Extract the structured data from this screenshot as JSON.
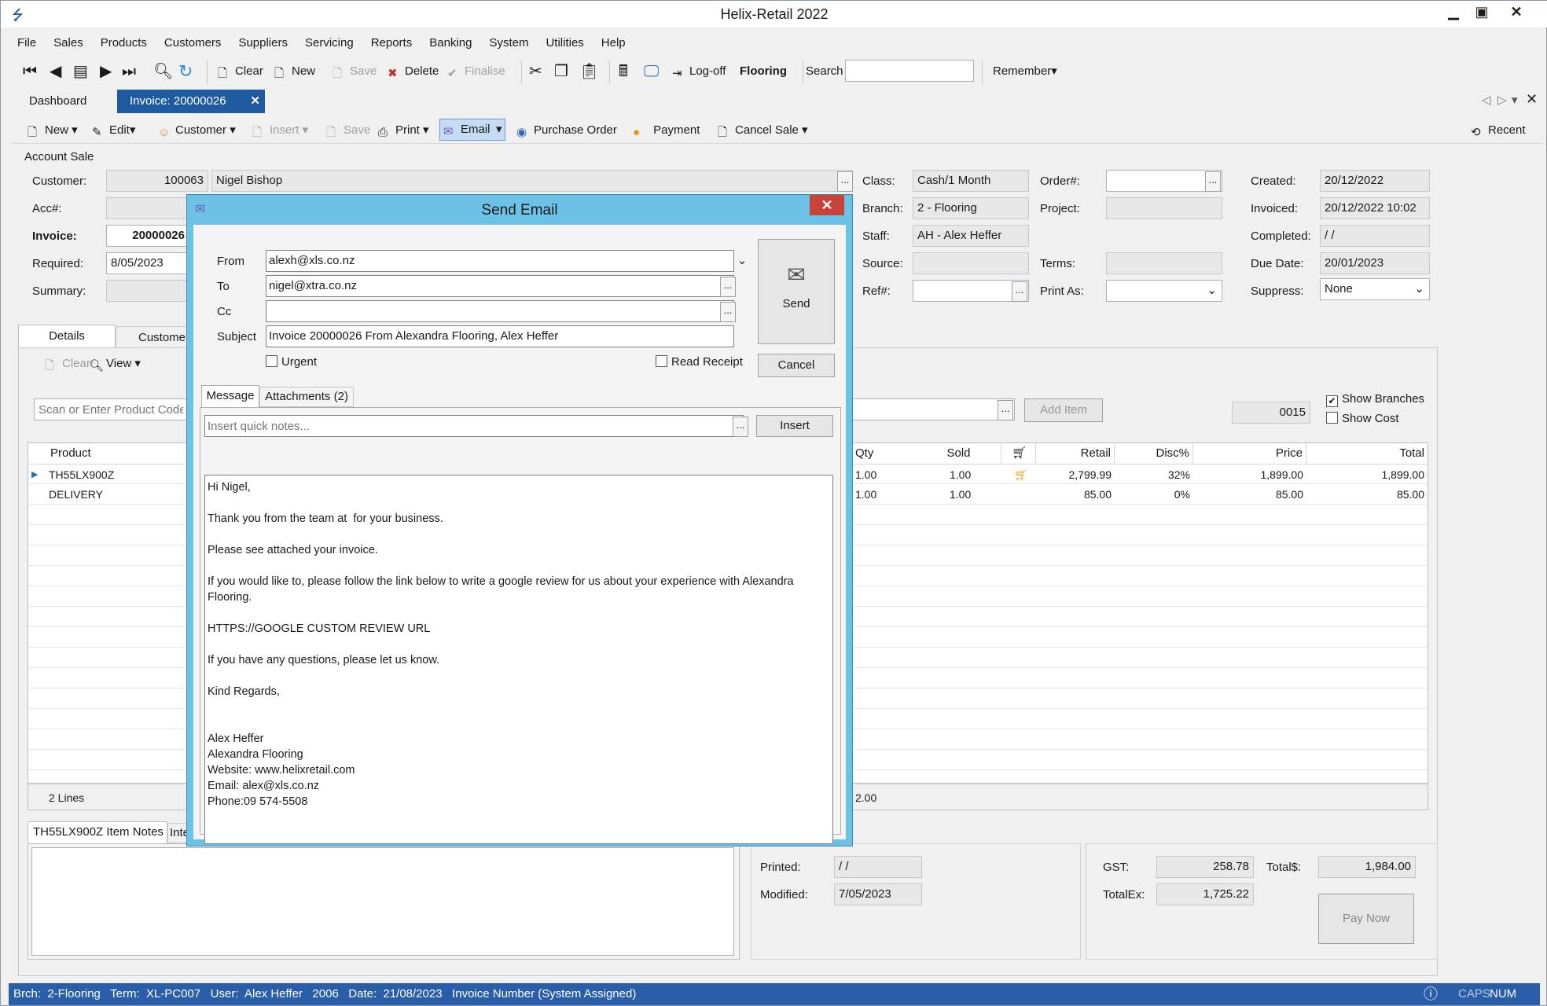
{
  "app": {
    "title": "Helix-Retail 2022"
  },
  "menu": [
    "File",
    "Sales",
    "Products",
    "Customers",
    "Suppliers",
    "Servicing",
    "Reports",
    "Banking",
    "System",
    "Utilities",
    "Help"
  ],
  "toolbar": {
    "clear": "Clear",
    "new": "New",
    "save": "Save",
    "delete": "Delete",
    "finalise": "Finalise",
    "logoff": "Log-off",
    "branch": "Flooring",
    "search_label": "Search",
    "search_value": "",
    "remember": "Remember"
  },
  "doctabs": {
    "dashboard": "Dashboard",
    "invoice": "Invoice: 20000026"
  },
  "invtoolbar": {
    "new": "New",
    "edit": "Edit",
    "customer": "Customer",
    "insert": "Insert",
    "save": "Save",
    "print": "Print",
    "email": "Email",
    "purchase_order": "Purchase Order",
    "payment": "Payment",
    "cancel_sale": "Cancel Sale",
    "recent": "Recent"
  },
  "account": {
    "section": "Account Sale",
    "customer_label": "Customer:",
    "customer_code": "100063",
    "customer_name": "Nigel Bishop",
    "acc_label": "Acc#:",
    "invoice_label": "Invoice:",
    "invoice_value": "20000026",
    "required_label": "Required:",
    "required_value": "8/05/2023",
    "summary_label": "Summary:",
    "class_label": "Class:",
    "class_value": "Cash/1 Month",
    "branch_label": "Branch:",
    "branch_value": "2 - Flooring",
    "staff_label": "Staff:",
    "staff_value": "AH - Alex Heffer",
    "source_label": "Source:",
    "ref_label": "Ref#:",
    "order_label": "Order#:",
    "project_label": "Project:",
    "terms_label": "Terms:",
    "printas_label": "Print As:",
    "created_label": "Created:",
    "created_value": "20/12/2022",
    "invoiced_label": "Invoiced:",
    "invoiced_value": "20/12/2022 10:02",
    "completed_label": "Completed:",
    "completed_value": " /  /",
    "due_label": "Due Date:",
    "due_value": "20/01/2023",
    "suppress_label": "Suppress:",
    "suppress_value": "None"
  },
  "details": {
    "tab_details": "Details",
    "tab_customer": "Customer",
    "clear": "Clear",
    "view": "View",
    "scan_placeholder": "Scan or Enter Product Code",
    "add_item": "Add Item",
    "code": "0015",
    "show_branches": "Show Branches",
    "show_cost": "Show Cost",
    "headers": {
      "product": "Product",
      "qty": "Qty",
      "sold": "Sold",
      "retail": "Retail",
      "disc": "Disc%",
      "price": "Price",
      "total": "Total"
    },
    "rows": [
      {
        "product": "TH55LX900Z",
        "qty": "1.00",
        "sold": "1.00",
        "retail": "2,799.99",
        "disc": "32%",
        "price": "1,899.00",
        "total": "1,899.00"
      },
      {
        "product": "DELIVERY",
        "qty": "1.00",
        "sold": "1.00",
        "retail": "85.00",
        "disc": "0%",
        "price": "85.00",
        "total": "85.00"
      }
    ],
    "lines": "2 Lines",
    "qty_total": "2.00"
  },
  "notes": {
    "tab_item": "TH55LX900Z Item Notes",
    "tab_internal": "Inte"
  },
  "totals": {
    "printed_label": "Printed:",
    "printed_value": " /  /",
    "modified_label": "Modified:",
    "modified_value": "7/05/2023",
    "gst_label": "GST:",
    "gst_value": "258.78",
    "totalex_label": "TotalEx:",
    "totalex_value": "1,725.22",
    "total_label": "Total$:",
    "total_value": "1,984.00",
    "pay_now": "Pay Now"
  },
  "status": {
    "text": "Brch:  2-Flooring   Term:  XL-PC007   User:  Alex Heffer   2006   Date:  21/08/2023   Invoice Number (System Assigned)",
    "caps": "CAPS",
    "num": "NUM"
  },
  "dialog": {
    "title": "Send Email",
    "from_label": "From",
    "from_value": "alexh@xls.co.nz",
    "to_label": "To",
    "to_value": "nigel@xtra.co.nz",
    "cc_label": "Cc",
    "cc_value": "",
    "subject_label": "Subject",
    "subject_value": "Invoice 20000026 From Alexandra Flooring, Alex Heffer",
    "urgent": "Urgent",
    "read_receipt": "Read Receipt",
    "send": "Send",
    "cancel": "Cancel",
    "tab_message": "Message",
    "tab_attachments": "Attachments (2)",
    "quick_notes_placeholder": "Insert quick notes...",
    "insert": "Insert",
    "message": "Hi Nigel,\n\nThank you from the team at  for your business.\n\nPlease see attached your invoice.\n\nIf you would like to, please follow the link below to write a google review for us about your experience with Alexandra Flooring.\n\nHTTPS://GOOGLE CUSTOM REVIEW URL\n\nIf you have any questions, please let us know.\n\nKind Regards,\n\n\nAlex Heffer\nAlexandra Flooring\nWebsite: www.helixretail.com\nEmail: alex@xls.co.nz\nPhone:09 574-5508"
  }
}
